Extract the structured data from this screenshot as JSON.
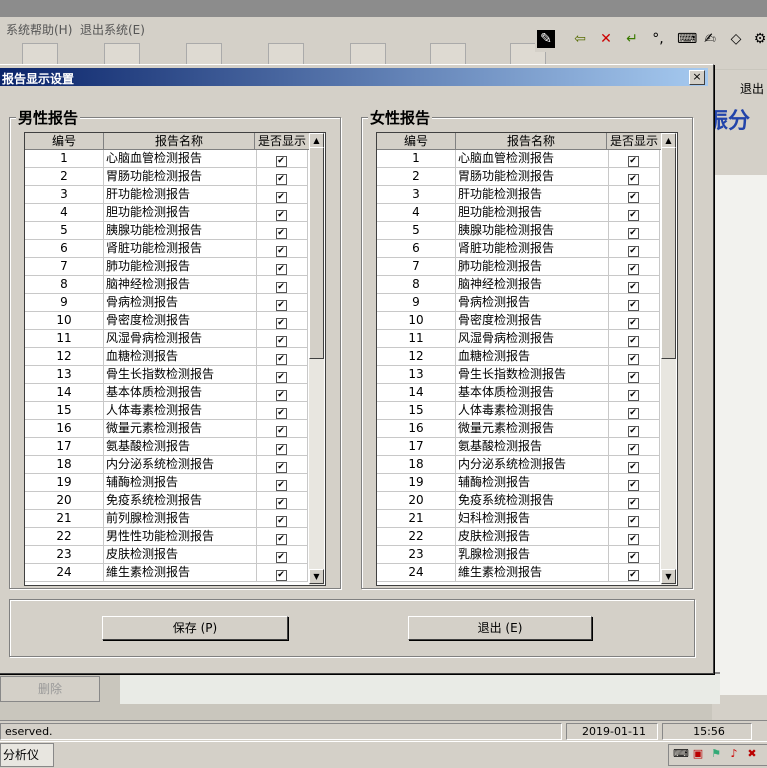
{
  "menu": {
    "help": "系统帮助(H)",
    "exit_system": "退出系统(E)"
  },
  "right_panel": {
    "exit_label": "退出",
    "brand_fragment": "振分"
  },
  "dialog": {
    "title": "报告显示设置",
    "close": "×",
    "male_title": "男性报告",
    "female_title": "女性报告",
    "columns": {
      "num": "编号",
      "name": "报告名称",
      "show": "是否显示"
    },
    "save_label": "保存 (P)",
    "exit_label": "退出 (E)"
  },
  "male_rows": [
    {
      "num": "1",
      "name": "心脑血管检测报告",
      "checked": true
    },
    {
      "num": "2",
      "name": "胃肠功能检测报告",
      "checked": true
    },
    {
      "num": "3",
      "name": "肝功能检测报告",
      "checked": true
    },
    {
      "num": "4",
      "name": "胆功能检测报告",
      "checked": true
    },
    {
      "num": "5",
      "name": "胰腺功能检测报告",
      "checked": true
    },
    {
      "num": "6",
      "name": "肾脏功能检测报告",
      "checked": true
    },
    {
      "num": "7",
      "name": "肺功能检测报告",
      "checked": true
    },
    {
      "num": "8",
      "name": "脑神经检测报告",
      "checked": true
    },
    {
      "num": "9",
      "name": "骨病检测报告",
      "checked": true
    },
    {
      "num": "10",
      "name": "骨密度检测报告",
      "checked": true
    },
    {
      "num": "11",
      "name": "风湿骨病检测报告",
      "checked": true
    },
    {
      "num": "12",
      "name": "血糖检测报告",
      "checked": true
    },
    {
      "num": "13",
      "name": "骨生长指数检测报告",
      "checked": true
    },
    {
      "num": "14",
      "name": "基本体质检测报告",
      "checked": true
    },
    {
      "num": "15",
      "name": "人体毒素检测报告",
      "checked": true
    },
    {
      "num": "16",
      "name": "微量元素检测报告",
      "checked": true
    },
    {
      "num": "17",
      "name": "氨基酸检测报告",
      "checked": true
    },
    {
      "num": "18",
      "name": "内分泌系统检测报告",
      "checked": true
    },
    {
      "num": "19",
      "name": "辅酶检测报告",
      "checked": true
    },
    {
      "num": "20",
      "name": "免疫系统检测报告",
      "checked": true
    },
    {
      "num": "21",
      "name": "前列腺检测报告",
      "checked": true
    },
    {
      "num": "22",
      "name": "男性性功能检测报告",
      "checked": true
    },
    {
      "num": "23",
      "name": "皮肤检测报告",
      "checked": true
    },
    {
      "num": "24",
      "name": "維生素检测报告",
      "checked": true
    }
  ],
  "female_rows": [
    {
      "num": "1",
      "name": "心脑血管检测报告",
      "checked": true
    },
    {
      "num": "2",
      "name": "胃肠功能检测报告",
      "checked": true
    },
    {
      "num": "3",
      "name": "肝功能检测报告",
      "checked": true
    },
    {
      "num": "4",
      "name": "胆功能检测报告",
      "checked": true
    },
    {
      "num": "5",
      "name": "胰腺功能检测报告",
      "checked": true
    },
    {
      "num": "6",
      "name": "肾脏功能检测报告",
      "checked": true
    },
    {
      "num": "7",
      "name": "肺功能检测报告",
      "checked": true
    },
    {
      "num": "8",
      "name": "脑神经检测报告",
      "checked": true
    },
    {
      "num": "9",
      "name": "骨病检测报告",
      "checked": true
    },
    {
      "num": "10",
      "name": "骨密度检测报告",
      "checked": true
    },
    {
      "num": "11",
      "name": "风湿骨病检测报告",
      "checked": true
    },
    {
      "num": "12",
      "name": "血糖检测报告",
      "checked": true
    },
    {
      "num": "13",
      "name": "骨生长指数检测报告",
      "checked": true
    },
    {
      "num": "14",
      "name": "基本体质检测报告",
      "checked": true
    },
    {
      "num": "15",
      "name": "人体毒素检测报告",
      "checked": true
    },
    {
      "num": "16",
      "name": "微量元素检测报告",
      "checked": true
    },
    {
      "num": "17",
      "name": "氨基酸检测报告",
      "checked": true
    },
    {
      "num": "18",
      "name": "内分泌系统检测报告",
      "checked": true
    },
    {
      "num": "19",
      "name": "辅酶检测报告",
      "checked": true
    },
    {
      "num": "20",
      "name": "免疫系统检测报告",
      "checked": true
    },
    {
      "num": "21",
      "name": "妇科检测报告",
      "checked": true
    },
    {
      "num": "22",
      "name": "皮肤检测报告",
      "checked": true
    },
    {
      "num": "23",
      "name": "乳腺检测报告",
      "checked": true
    },
    {
      "num": "24",
      "name": "維生素检测报告",
      "checked": true
    }
  ],
  "background": {
    "delete_label": "删除"
  },
  "statusbar": {
    "left": "eserved.",
    "date": "2019-01-11",
    "time": "15:56"
  },
  "taskbar": {
    "app_label": "分析仪"
  },
  "colors": {
    "title_start": "#0a246a",
    "title_end": "#a6caf0",
    "face": "#d4d0c8"
  }
}
